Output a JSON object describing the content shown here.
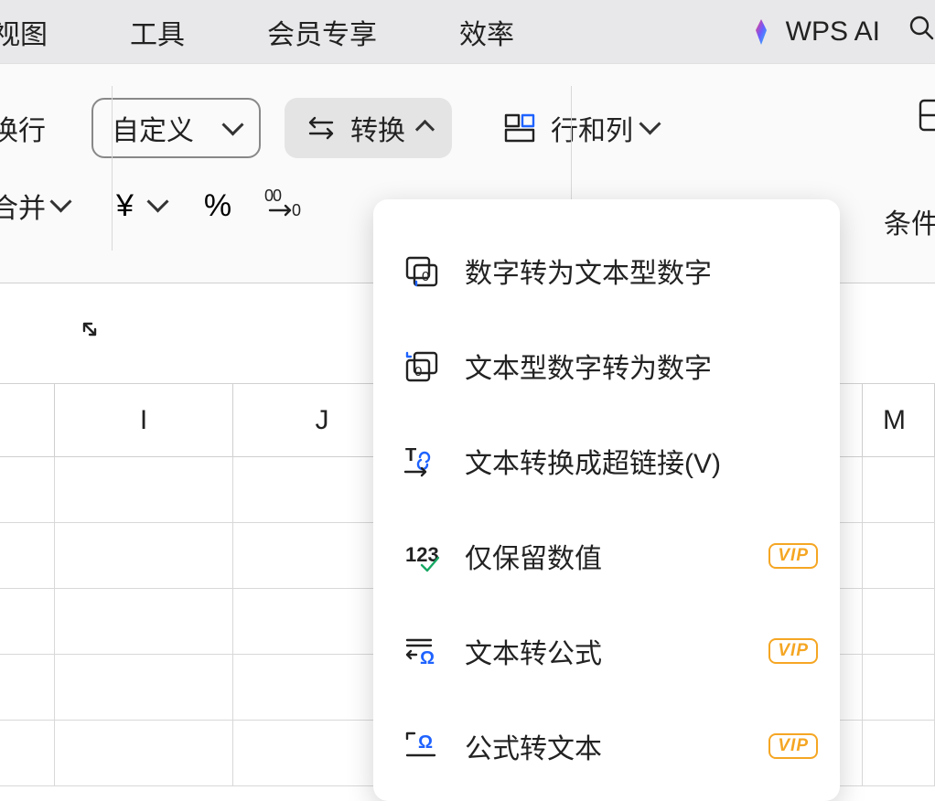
{
  "menu": {
    "tabs": [
      "视图",
      "工具",
      "会员专享",
      "效率"
    ],
    "wps_ai_label": "WPS AI"
  },
  "ribbon": {
    "wrap_label": "换行",
    "merge_label": "合并",
    "custom_select_label": "自定义",
    "convert_button_label": "转换",
    "rowcol_button_label": "行和列",
    "currency_symbol": "¥",
    "percent_symbol": "%",
    "decimal_indicator": "⁰⁰₀",
    "condition_label": "条件"
  },
  "columns": {
    "I": "I",
    "J": "J",
    "M_partial": "M"
  },
  "convert_menu": {
    "items": [
      {
        "label": "数字转为文本型数字",
        "icon": "num-to-textnum",
        "vip": false
      },
      {
        "label": "文本型数字转为数字",
        "icon": "textnum-to-num",
        "vip": false
      },
      {
        "label": "文本转换成超链接(V)",
        "icon": "text-to-hyperlink",
        "vip": false
      },
      {
        "label": "仅保留数值",
        "icon": "keep-values",
        "vip": true
      },
      {
        "label": "文本转公式",
        "icon": "text-to-formula",
        "vip": true
      },
      {
        "label": "公式转文本",
        "icon": "formula-to-text",
        "vip": true
      }
    ],
    "vip_badge_text": "VIP"
  }
}
